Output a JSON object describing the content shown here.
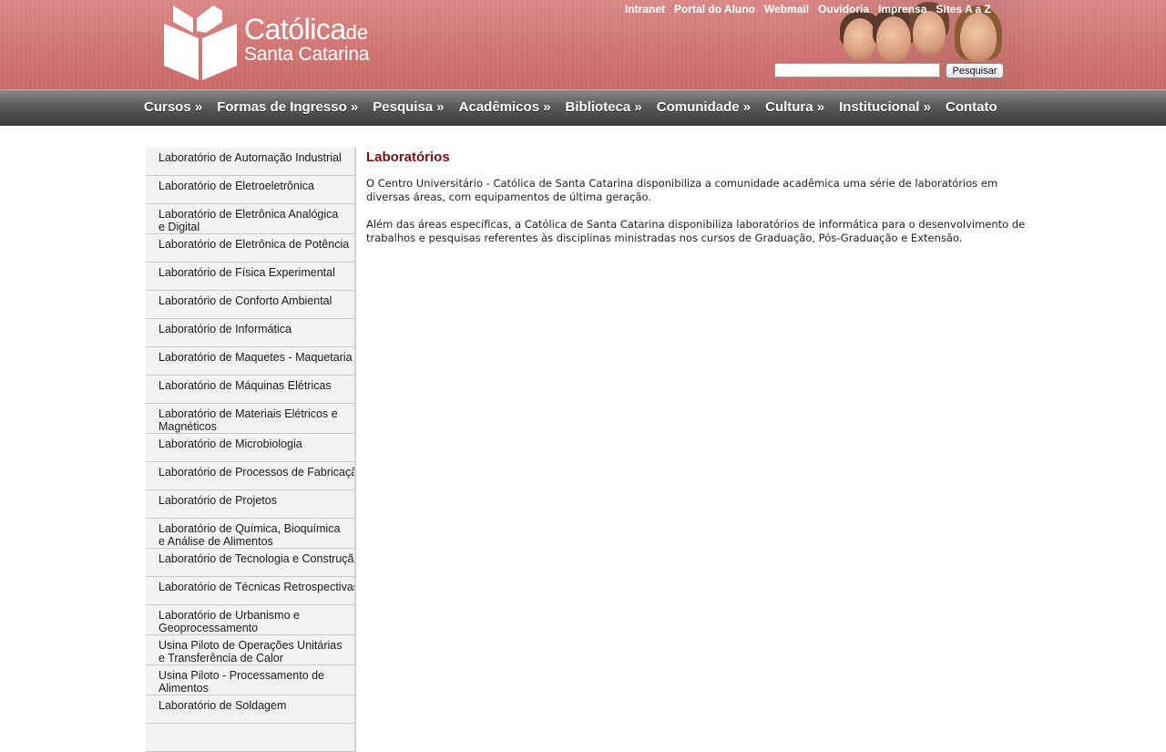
{
  "header": {
    "brand_name": "Católica",
    "brand_de": "de",
    "brand_sub": "Santa Catarina",
    "top_links": [
      "Intranet",
      "Portal do Aluno",
      "Webmail",
      "Ouvidoria",
      "Imprensa",
      "Sites A a Z"
    ],
    "search": {
      "placeholder": "",
      "value": "",
      "button_label": "Pesquisar"
    }
  },
  "nav": {
    "items": [
      "Cursos »",
      "Formas de Ingresso »",
      "Pesquisa »",
      "Acadêmicos »",
      "Biblioteca »",
      "Comunidade »",
      "Cultura »",
      "Institucional »",
      "Contato"
    ]
  },
  "sidebar": {
    "items": [
      "Laboratório de Automação Industrial",
      "Laboratório de Eletroeletrônica",
      "Laboratório de Eletrônica Analógica e Digital",
      "Laboratório de Eletrônica de Potência",
      "Laboratório de Física Experimental",
      "Laboratório de Conforto Ambiental",
      "Laboratório de Informática",
      "Laboratório de Maquetes - Maquetaria",
      "Laboratório de Máquinas Elétricas",
      "Laboratório de Materiais Elétricos e Magnéticos",
      "Laboratório de Microbiologia",
      "Laboratório de Processos de Fabricação",
      "Laboratório de Projetos",
      "Laboratório de Química, Bioquímica e Análise de Alimentos",
      "Laboratório de Tecnologia e Construção",
      "Laboratório de Técnicas Retrospectivas",
      "Laboratório de Urbanismo e Geoprocessamento",
      "Usina Piloto de Operações Unitárias e Transferência de Calor",
      "Usina Piloto - Processamento de Alimentos",
      "Laboratório de Soldagem"
    ]
  },
  "main": {
    "title": "Laboratórios",
    "paragraphs": [
      "O Centro Universitário - Católica de Santa Catarina disponibiliza a comunidade acadêmica uma série de laboratórios em diversas áreas, com equipamentos de última geração.",
      "Além das áreas específicas, a Católica de Santa Catarina disponibiliza laboratórios de informática para o desenvolvimento de trabalhos e pesquisas referentes às disciplinas ministradas nos cursos de Graduação, Pós-Graduação e Extensão."
    ]
  },
  "colors": {
    "header_bg": "#cf7472",
    "nav_bg": "#4a4a4a",
    "title_color": "#7b1010",
    "sidebar_bg": "#f3f3f3"
  }
}
